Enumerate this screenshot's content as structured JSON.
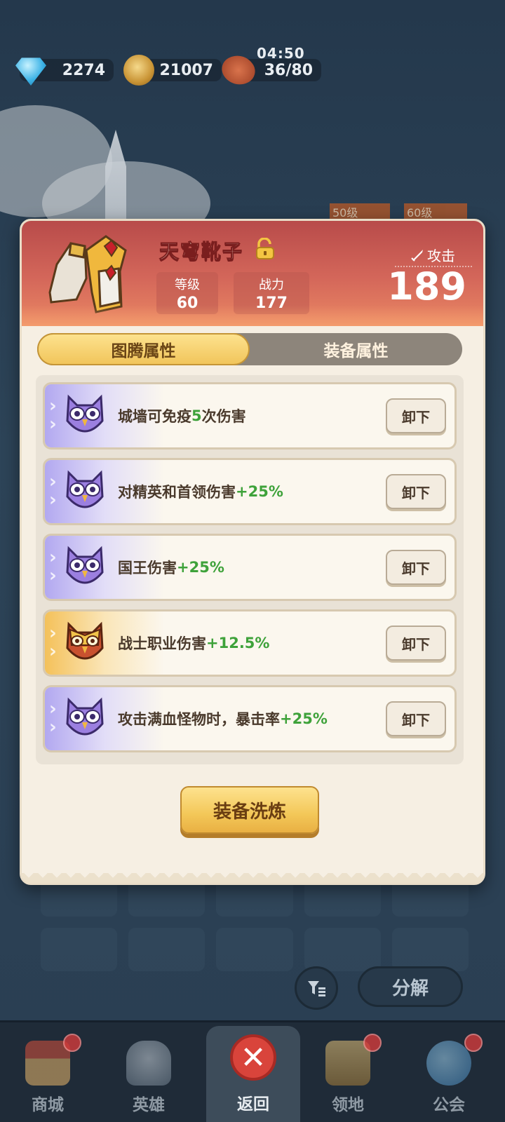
{
  "resources": {
    "gems": "2274",
    "coins": "21007",
    "stamina": "36/80",
    "timer": "04:50"
  },
  "background": {
    "badges": [
      "50级",
      "60级"
    ]
  },
  "item": {
    "name": "天穹靴子",
    "level_label": "等级",
    "level_value": "60",
    "power_label": "战力",
    "power_value": "177",
    "attack_label": "攻击",
    "attack_value": "189"
  },
  "tabs": {
    "totem": "图腾属性",
    "equipment": "装备属性",
    "active": "totem"
  },
  "totems": [
    {
      "color": "purple",
      "text": "城墙可免疫",
      "highlight": "5",
      "suffix": "次伤害",
      "button": "卸下"
    },
    {
      "color": "purple",
      "text": "对精英和首领伤害",
      "highlight": "+25%",
      "suffix": "",
      "button": "卸下"
    },
    {
      "color": "purple",
      "text": "国王伤害",
      "highlight": "+25%",
      "suffix": "",
      "button": "卸下"
    },
    {
      "color": "gold",
      "text": "战士职业伤害",
      "highlight": "+12.5%",
      "suffix": "",
      "button": "卸下"
    },
    {
      "color": "purple",
      "text": "攻击满血怪物时，暴击率",
      "highlight": "+25%",
      "suffix": "",
      "button": "卸下"
    }
  ],
  "refine_button": "装备洗炼",
  "decompose_button": "分解",
  "nav": {
    "shop": "商城",
    "heroes": "英雄",
    "back": "返回",
    "territory": "领地",
    "guild": "公会"
  },
  "colors": {
    "highlight_green": "#3ea23a",
    "header_red": "#c95a52",
    "tab_gold": "#f1c55b",
    "rarity_purple": "#9d86e8",
    "rarity_gold": "#f4c15a"
  }
}
